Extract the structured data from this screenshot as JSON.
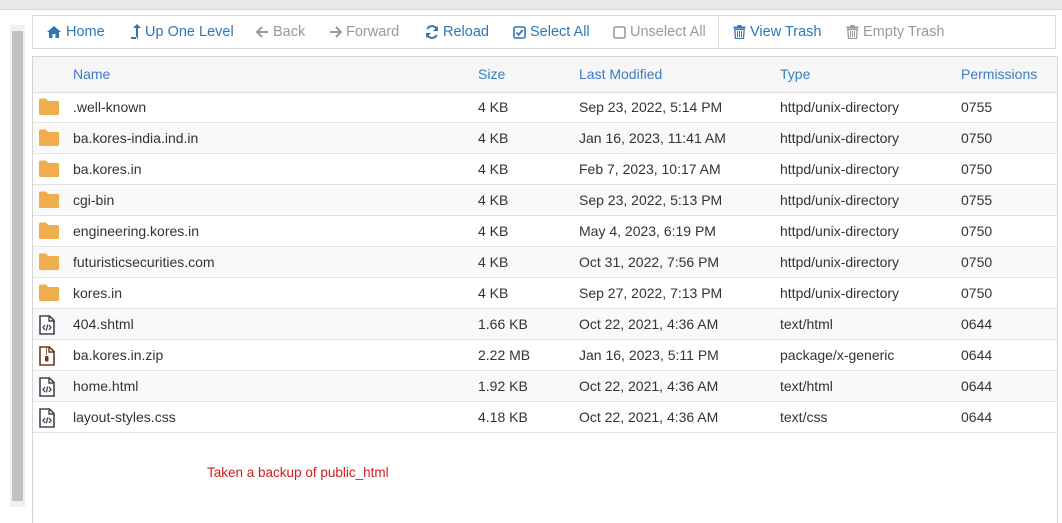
{
  "toolbar": {
    "home": "Home",
    "up_one_level": "Up One Level",
    "back": "Back",
    "forward": "Forward",
    "reload": "Reload",
    "select_all": "Select All",
    "unselect_all": "Unselect All",
    "view_trash": "View Trash",
    "empty_trash": "Empty Trash"
  },
  "columns": {
    "name": "Name",
    "size": "Size",
    "last_modified": "Last Modified",
    "type": "Type",
    "permissions": "Permissions"
  },
  "files": [
    {
      "icon": "folder-icon",
      "name": ".well-known",
      "size": "4 KB",
      "modified": "Sep 23, 2022, 5:14 PM",
      "type": "httpd/unix-directory",
      "perms": "0755"
    },
    {
      "icon": "folder-icon",
      "name": "ba.kores-india.ind.in",
      "size": "4 KB",
      "modified": "Jan 16, 2023, 11:41 AM",
      "type": "httpd/unix-directory",
      "perms": "0750"
    },
    {
      "icon": "folder-icon",
      "name": "ba.kores.in",
      "size": "4 KB",
      "modified": "Feb 7, 2023, 10:17 AM",
      "type": "httpd/unix-directory",
      "perms": "0750"
    },
    {
      "icon": "folder-icon",
      "name": "cgi-bin",
      "size": "4 KB",
      "modified": "Sep 23, 2022, 5:13 PM",
      "type": "httpd/unix-directory",
      "perms": "0755"
    },
    {
      "icon": "folder-icon",
      "name": "engineering.kores.in",
      "size": "4 KB",
      "modified": "May 4, 2023, 6:19 PM",
      "type": "httpd/unix-directory",
      "perms": "0750"
    },
    {
      "icon": "folder-icon",
      "name": "futuristicsecurities.com",
      "size": "4 KB",
      "modified": "Oct 31, 2022, 7:56 PM",
      "type": "httpd/unix-directory",
      "perms": "0750"
    },
    {
      "icon": "folder-icon",
      "name": "kores.in",
      "size": "4 KB",
      "modified": "Sep 27, 2022, 7:13 PM",
      "type": "httpd/unix-directory",
      "perms": "0750"
    },
    {
      "icon": "code-file-icon",
      "name": "404.shtml",
      "size": "1.66 KB",
      "modified": "Oct 22, 2021, 4:36 AM",
      "type": "text/html",
      "perms": "0644"
    },
    {
      "icon": "zip-file-icon",
      "name": "ba.kores.in.zip",
      "size": "2.22 MB",
      "modified": "Jan 16, 2023, 5:11 PM",
      "type": "package/x-generic",
      "perms": "0644"
    },
    {
      "icon": "code-file-icon",
      "name": "home.html",
      "size": "1.92 KB",
      "modified": "Oct 22, 2021, 4:36 AM",
      "type": "text/html",
      "perms": "0644"
    },
    {
      "icon": "code-file-icon",
      "name": "layout-styles.css",
      "size": "4.18 KB",
      "modified": "Oct 22, 2021, 4:36 AM",
      "type": "text/css",
      "perms": "0644"
    }
  ],
  "note": "Taken a backup of public_html",
  "colors": {
    "link": "#2f76b7",
    "header_text": "#3b7dc4",
    "folder": "#f0ad4e",
    "note": "#d21c1c",
    "disabled": "#999999"
  }
}
